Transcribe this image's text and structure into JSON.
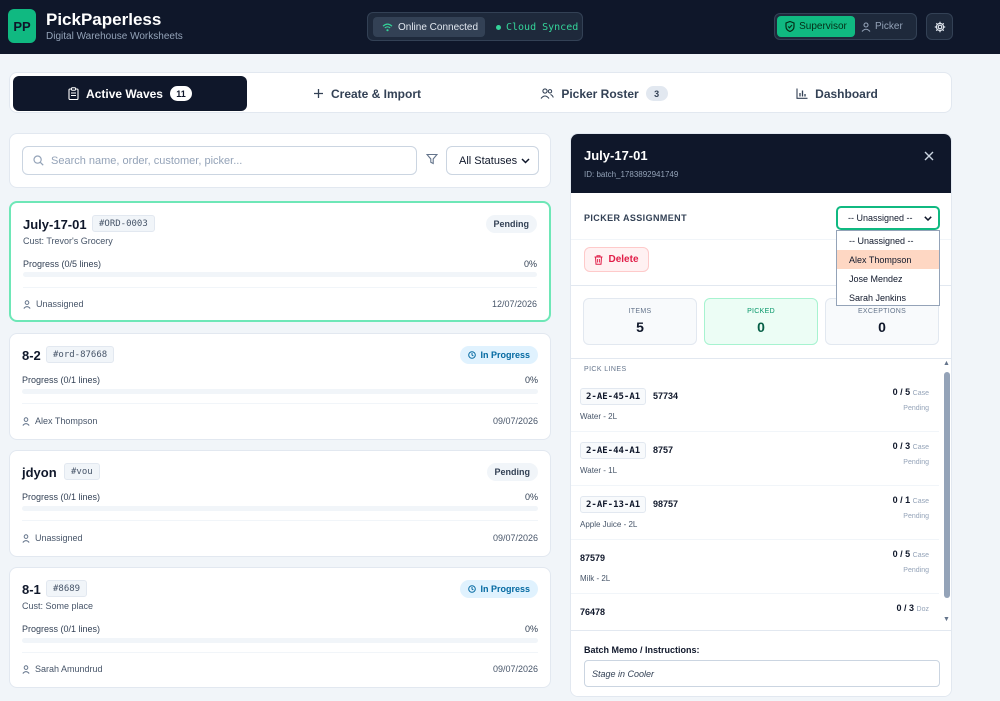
{
  "app": {
    "logo": "PP",
    "title": "PickPaperless",
    "subtitle": "Digital Warehouse Worksheets",
    "online": "Online Connected",
    "cloud": "Cloud Synced",
    "roles": {
      "supervisor": "Supervisor",
      "picker": "Picker"
    },
    "accent": "#10b981",
    "header_bg": "#0f172a"
  },
  "tabs": [
    {
      "label": "Active Waves",
      "badge": "11",
      "icon": "clipboard-icon"
    },
    {
      "label": "Create & Import",
      "icon": "plus-icon"
    },
    {
      "label": "Picker Roster",
      "badge": "3",
      "icon": "users-icon"
    },
    {
      "label": "Dashboard",
      "icon": "bar-chart-icon"
    }
  ],
  "filters": {
    "search_placeholder": "Search name, order, customer, picker...",
    "status": "All Statuses"
  },
  "waves": [
    {
      "name": "July-17-01",
      "order": "#ORD-0003",
      "customer": "Cust: Trevor's Grocery",
      "status": "Pending",
      "progress_label": "Progress (0/5 lines)",
      "progress_pct": "0%",
      "progress": 0,
      "picker": "Unassigned",
      "date": "12/07/2026"
    },
    {
      "name": "8-2",
      "order": "#ord-87668",
      "customer": "",
      "status": "In Progress",
      "progress_label": "Progress (0/1 lines)",
      "progress_pct": "0%",
      "progress": 0,
      "picker": "Alex Thompson",
      "date": "09/07/2026"
    },
    {
      "name": "jdyon",
      "order": "#vou",
      "customer": "",
      "status": "Pending",
      "progress_label": "Progress (0/1 lines)",
      "progress_pct": "0%",
      "progress": 0,
      "picker": "Unassigned",
      "date": "09/07/2026"
    },
    {
      "name": "8-1",
      "order": "#8689",
      "customer": "Cust: Some place",
      "status": "In Progress",
      "progress_label": "Progress (0/1 lines)",
      "progress_pct": "0%",
      "progress": 0,
      "picker": "Sarah Amundrud",
      "date": "09/07/2026"
    }
  ],
  "detail": {
    "title": "July-17-01",
    "id": "ID: batch_1783892941749",
    "assignment_label": "PICKER ASSIGNMENT",
    "assignment_value": "-- Unassigned --",
    "assignment_options": [
      "-- Unassigned --",
      "Alex Thompson",
      "Jose Mendez",
      "Sarah Jenkins"
    ],
    "delete_label": "Delete",
    "stats": {
      "items_label": "ITEMS",
      "items": "5",
      "picked_label": "PICKED",
      "picked": "0",
      "exceptions_label": "EXCEPTIONS",
      "exceptions": "0"
    },
    "pick_lines_label": "PICK LINES",
    "pick_lines": [
      {
        "location": "2-AE-45-A1",
        "sku": "57734",
        "desc": "Water - 2L",
        "qty": "0 / 5",
        "unit": "Case",
        "status": "Pending"
      },
      {
        "location": "2-AE-44-A1",
        "sku": "8757",
        "desc": "Water - 1L",
        "qty": "0 / 3",
        "unit": "Case",
        "status": "Pending"
      },
      {
        "location": "2-AF-13-A1",
        "sku": "98757",
        "desc": "Apple Juice - 2L",
        "qty": "0 / 1",
        "unit": "Case",
        "status": "Pending"
      },
      {
        "location": "",
        "sku": "87579",
        "desc": "Milk - 2L",
        "qty": "0 / 5",
        "unit": "Case",
        "status": "Pending"
      },
      {
        "location": "",
        "sku": "76478",
        "desc": "",
        "qty": "0 / 3",
        "unit": "Doz",
        "status": ""
      }
    ],
    "memo_label": "Batch Memo / Instructions:",
    "memo_value": "Stage in Cooler"
  }
}
